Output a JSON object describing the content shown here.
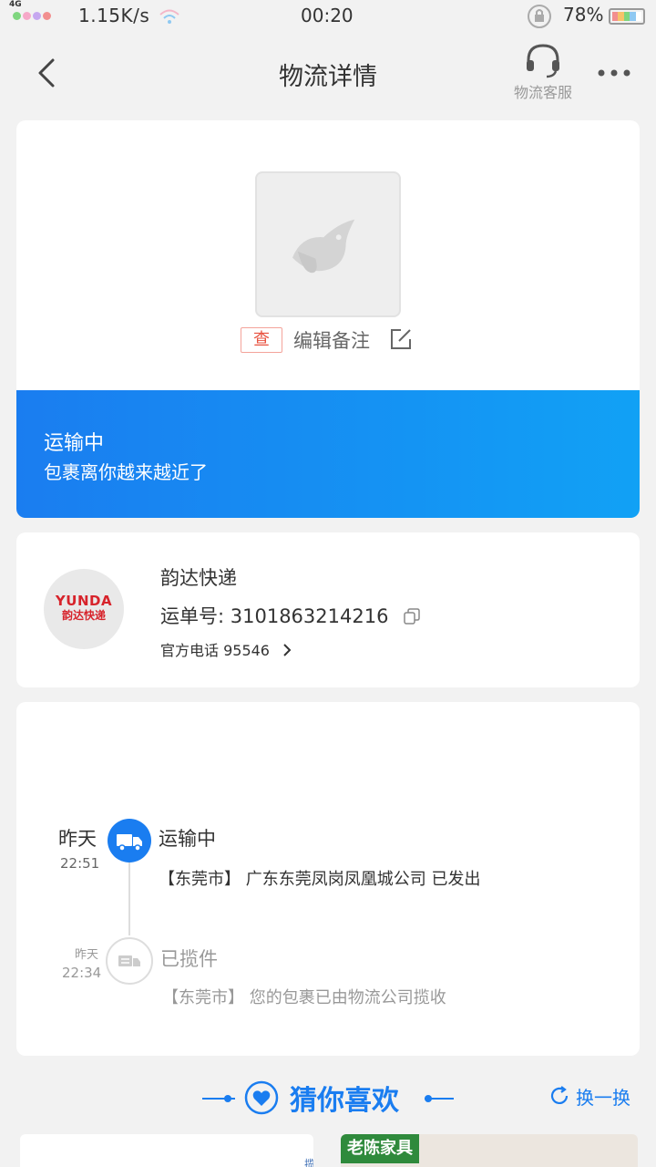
{
  "status_bar": {
    "network": "4G",
    "speed": "1.15K/s",
    "time": "00:20",
    "battery": "78%",
    "signal_colors": [
      "#7fd67f",
      "#f6a8c8",
      "#c6a8f0",
      "#f28f8f"
    ]
  },
  "nav": {
    "title": "物流详情",
    "customer_service": "物流客服"
  },
  "package": {
    "badge": "查",
    "edit_remark": "编辑备注"
  },
  "shipping_status": {
    "title": "运输中",
    "subtitle": "包裹离你越来越近了"
  },
  "courier": {
    "logo_text": "YUNDA",
    "logo_subtext": "韵达快递",
    "name": "韵达快递",
    "waybill": "运单号: 3101863214216",
    "phone": "官方电话 95546"
  },
  "timeline": [
    {
      "day": "昨天",
      "time": "22:51",
      "status": "运输中",
      "desc": "【东莞市】 广东东莞凤岗凤凰城公司 已发出"
    },
    {
      "day": "昨天",
      "time": "22:34",
      "status": "已揽件",
      "desc": "【东莞市】 您的包裹已由物流公司揽收"
    }
  ],
  "recommend": {
    "title": "猜你喜欢",
    "refresh": "换一换",
    "items": [
      {
        "label": "揽星社区"
      },
      {
        "brand": "老陈家具"
      }
    ]
  },
  "colors": {
    "accent": "#1a7df0",
    "badge_red": "#e8513f"
  }
}
